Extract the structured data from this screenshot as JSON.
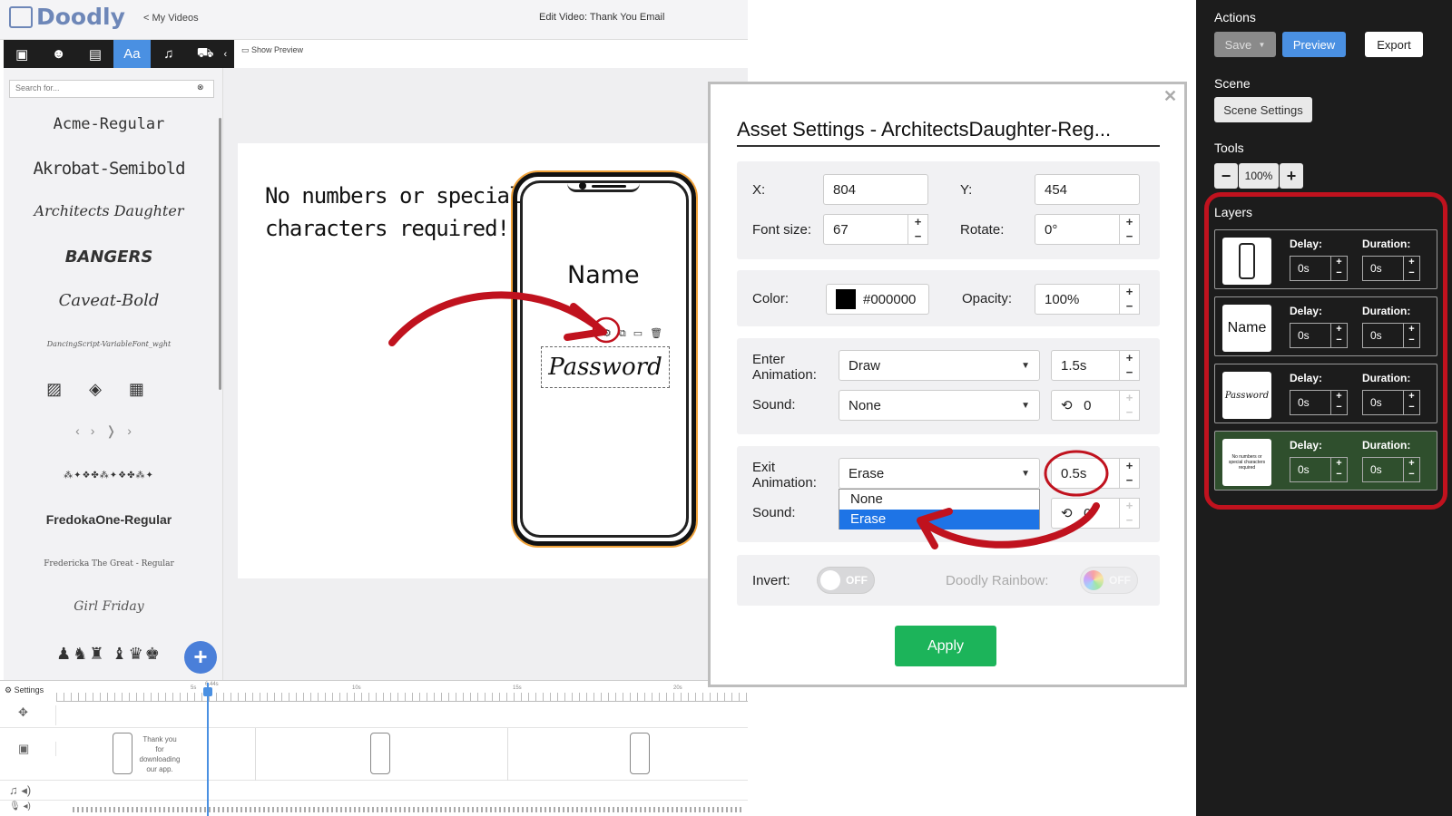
{
  "app": {
    "logo": "Doodly",
    "back_link": "< My Videos",
    "edit_title": "Edit Video: Thank You Email",
    "show_preview": "Show Preview"
  },
  "font_panel": {
    "search_placeholder": "Search for...",
    "fonts": [
      "Acme-Regular",
      "Akrobat-Semibold",
      "Architects Daughter",
      "BANGERS",
      "Caveat-Bold",
      "DancingScript-VariableFont_wght",
      "FredokaOne-Regular",
      "Fredericka The Great - Regular",
      "Girl Friday"
    ]
  },
  "canvas": {
    "text": "No numbers or special\ncharacters required!",
    "phone_name": "Name",
    "phone_password": "Password"
  },
  "timeline": {
    "settings_label": "Settings",
    "ticks": [
      "5s",
      "10s",
      "15s",
      "20s"
    ],
    "playhead_label": "6.44s",
    "clip1_text": "Thank you for downloading our app."
  },
  "modal": {
    "title": "Asset Settings - ArchitectsDaughter-Reg...",
    "x_label": "X:",
    "x_value": "804",
    "y_label": "Y:",
    "y_value": "454",
    "font_size_label": "Font size:",
    "font_size_value": "67",
    "rotate_label": "Rotate:",
    "rotate_value": "0°",
    "color_label": "Color:",
    "color_value": "#000000",
    "opacity_label": "Opacity:",
    "opacity_value": "100%",
    "enter_label": "Enter\nAnimation:",
    "enter_value": "Draw",
    "enter_duration": "1.5s",
    "sound_label": "Sound:",
    "enter_sound": "None",
    "enter_loop": "0",
    "exit_label": "Exit\nAnimation:",
    "exit_value": "Erase",
    "exit_duration": "0.5s",
    "exit_sound_label": "Sound:",
    "exit_loop": "0",
    "dropdown_options": [
      "None",
      "Erase"
    ],
    "invert_label": "Invert:",
    "invert_state": "OFF",
    "rainbow_label": "Doodly Rainbow:",
    "rainbow_state": "OFF",
    "apply_label": "Apply"
  },
  "right_panel": {
    "actions_heading": "Actions",
    "save_label": "Save",
    "preview_label": "Preview",
    "export_label": "Export",
    "scene_heading": "Scene",
    "scene_settings_label": "Scene Settings",
    "tools_heading": "Tools",
    "zoom_value": "100%",
    "layers_heading": "Layers",
    "delay_label": "Delay:",
    "duration_label": "Duration:",
    "layers": [
      {
        "thumb": "",
        "delay": "0s",
        "duration": "0s"
      },
      {
        "thumb": "Name",
        "delay": "0s",
        "duration": "0s"
      },
      {
        "thumb": "Password",
        "delay": "0s",
        "duration": "0s"
      },
      {
        "thumb": "No numbers or special characters required",
        "delay": "0s",
        "duration": "0s"
      }
    ]
  },
  "colors": {
    "accent_blue": "#4a90e2",
    "apply_green": "#1cb45a",
    "annotation_red": "#c0121e",
    "panel_dark": "#1c1c1c"
  }
}
